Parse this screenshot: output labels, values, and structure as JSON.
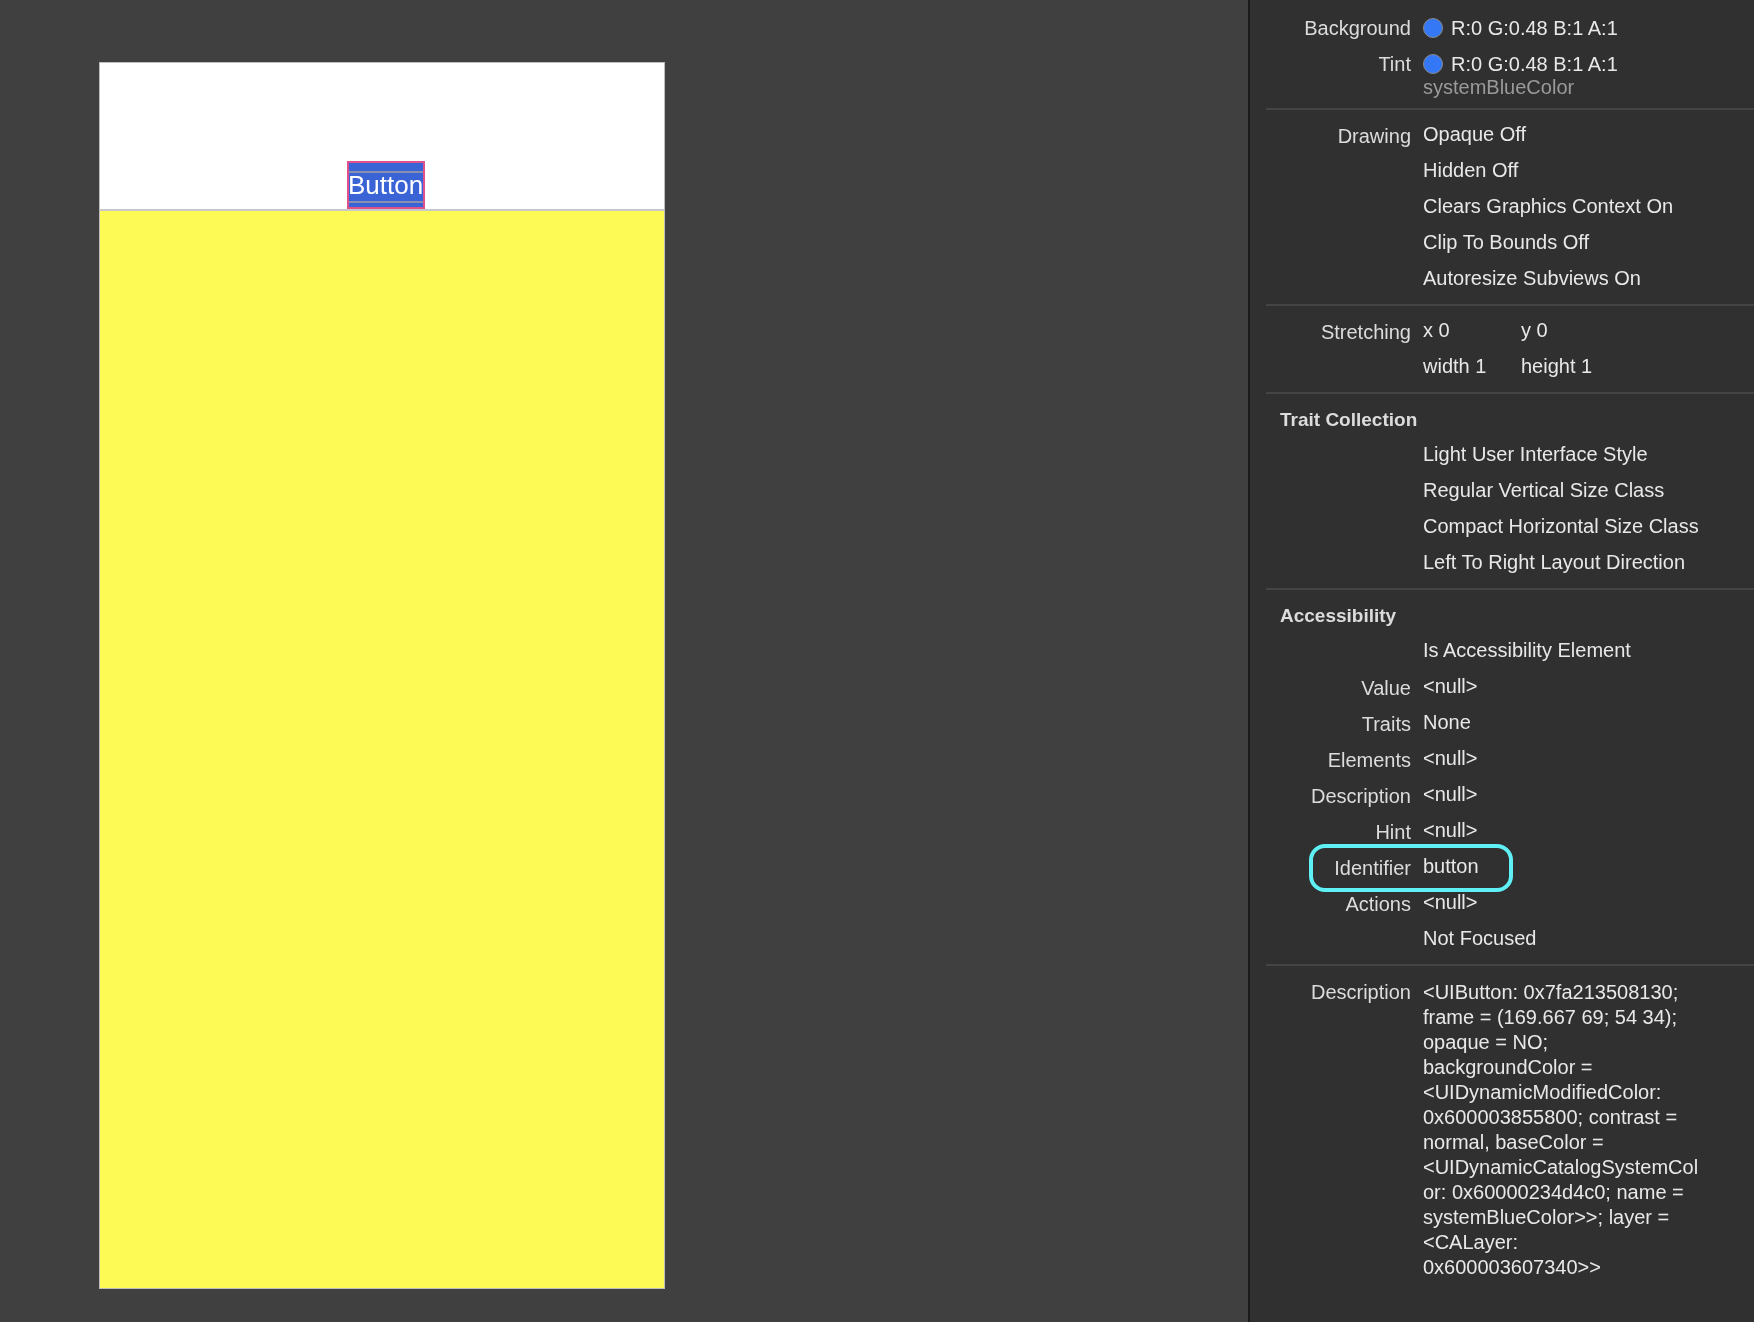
{
  "canvas": {
    "button": {
      "label": "Button",
      "selected": true
    }
  },
  "inspector": {
    "sections": [
      {
        "rows": [
          {
            "kind": "color",
            "label": "Background",
            "color": "#3478f6",
            "value": "R:0 G:0.48 B:1 A:1"
          },
          {
            "kind": "color",
            "label": "Tint",
            "color": "#3478f6",
            "value": "R:0 G:0.48 B:1 A:1",
            "subtext": "systemBlueColor"
          }
        ]
      },
      {
        "rows": [
          {
            "kind": "text",
            "label": "Drawing",
            "value": "Opaque Off"
          },
          {
            "kind": "text",
            "value": "Hidden Off"
          },
          {
            "kind": "text",
            "value": "Clears Graphics Context On"
          },
          {
            "kind": "text",
            "value": "Clip To Bounds Off"
          },
          {
            "kind": "text",
            "value": "Autoresize Subviews On"
          }
        ]
      },
      {
        "rows": [
          {
            "kind": "pair",
            "label": "Stretching",
            "cells": [
              "x 0",
              "y 0"
            ]
          },
          {
            "kind": "pair",
            "cells": [
              "width 1",
              "height 1"
            ]
          }
        ]
      },
      {
        "title": "Trait Collection",
        "rows": [
          {
            "kind": "text",
            "value": "Light User Interface Style"
          },
          {
            "kind": "text",
            "value": "Regular Vertical Size Class"
          },
          {
            "kind": "text",
            "value": "Compact Horizontal Size Class"
          },
          {
            "kind": "text",
            "value": "Left To Right Layout Direction"
          }
        ]
      },
      {
        "title": "Accessibility",
        "rows": [
          {
            "kind": "text",
            "value": "Is Accessibility Element"
          },
          {
            "kind": "text",
            "label": "Value",
            "value": "<null>"
          },
          {
            "kind": "text",
            "label": "Traits",
            "value": "None"
          },
          {
            "kind": "text",
            "label": "Elements",
            "value": "<null>"
          },
          {
            "kind": "text",
            "label": "Description",
            "value": "<null>"
          },
          {
            "kind": "text",
            "label": "Hint",
            "value": "<null>"
          },
          {
            "kind": "text",
            "label": "Identifier",
            "value": "button",
            "highlighted": true
          },
          {
            "kind": "text",
            "label": "Actions",
            "value": "<null>"
          },
          {
            "kind": "text",
            "value": "Not Focused"
          }
        ]
      },
      {
        "rows": [
          {
            "kind": "lines",
            "label": "Description",
            "lines": [
              "<UIButton: 0x7fa213508130;",
              "frame = (169.667 69; 54 34);",
              "opaque = NO;",
              "backgroundColor =",
              "<UIDynamicModifiedColor:",
              "0x600003855800; contrast =",
              "normal, baseColor =",
              "<UIDynamicCatalogSystemCol",
              "or: 0x60000234d4c0; name =",
              "systemBlueColor>>; layer =",
              "<CALayer:",
              "0x600003607340>>"
            ]
          }
        ]
      }
    ]
  }
}
